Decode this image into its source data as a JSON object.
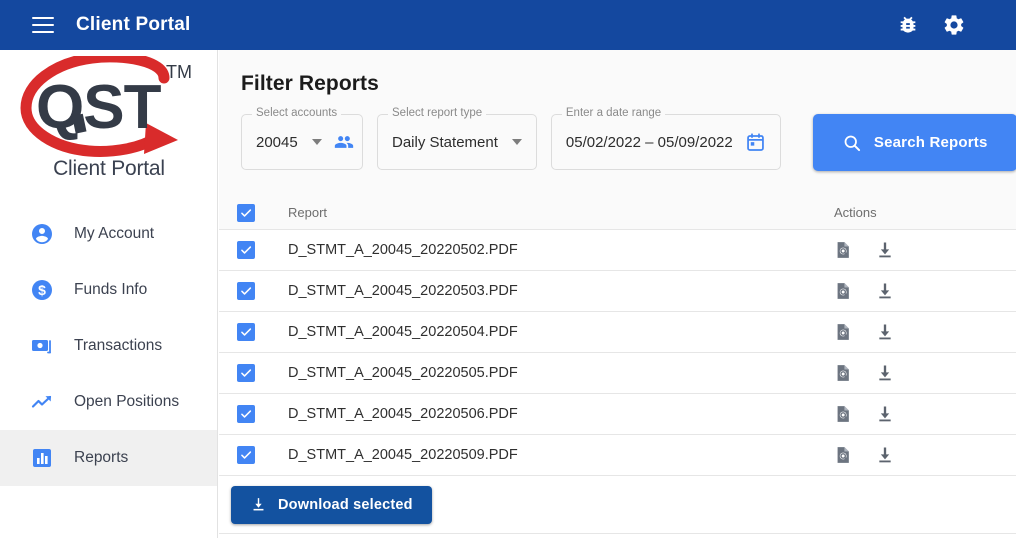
{
  "appbar": {
    "title": "Client Portal",
    "menu_icon": "hamburger-menu-icon",
    "bug_icon": "bug-icon",
    "settings_icon": "gear-icon",
    "background": "#14489f"
  },
  "sidebar": {
    "logo": {
      "wordmark": "QST",
      "trademark": "TM",
      "caption": "Client Portal",
      "swoosh_color": "#d92b2b",
      "wordmark_color": "#343b47"
    },
    "items": [
      {
        "label": "My Account",
        "icon": "account-circle-icon",
        "active": false
      },
      {
        "label": "Funds Info",
        "icon": "dollar-circle-icon",
        "active": false
      },
      {
        "label": "Transactions",
        "icon": "money-bill-icon",
        "active": false
      },
      {
        "label": "Open Positions",
        "icon": "trending-up-icon",
        "active": false
      },
      {
        "label": "Reports",
        "icon": "bar-chart-icon",
        "active": true
      }
    ],
    "active_background": "#f0f0f0"
  },
  "main": {
    "panel_title": "Filter Reports",
    "filters": [
      {
        "legend": "Select accounts",
        "value": "20045",
        "has_caret": true,
        "trailing_icon": "people-group-icon"
      },
      {
        "legend": "Select report type",
        "value": "Daily Statement",
        "has_caret": true,
        "trailing_icon": null
      },
      {
        "legend": "Enter a date range",
        "value": "05/02/2022 – 05/09/2022",
        "has_caret": false,
        "trailing_icon": "calendar-icon"
      }
    ],
    "search_button": {
      "label": "Search Reports",
      "icon": "search-icon",
      "color": "#4285f4"
    },
    "table": {
      "select_all_checked": true,
      "columns": {
        "report": "Report",
        "actions": "Actions"
      },
      "action_icons": [
        "document-preview-icon",
        "download-icon"
      ],
      "rows": [
        {
          "checked": true,
          "report": "D_STMT_A_20045_20220502.PDF"
        },
        {
          "checked": true,
          "report": "D_STMT_A_20045_20220503.PDF"
        },
        {
          "checked": true,
          "report": "D_STMT_A_20045_20220504.PDF"
        },
        {
          "checked": true,
          "report": "D_STMT_A_20045_20220505.PDF"
        },
        {
          "checked": true,
          "report": "D_STMT_A_20045_20220506.PDF"
        },
        {
          "checked": true,
          "report": "D_STMT_A_20045_20220509.PDF"
        }
      ]
    },
    "download_button": {
      "label": "Download selected",
      "icon": "download-icon",
      "color": "#1352a0"
    }
  }
}
